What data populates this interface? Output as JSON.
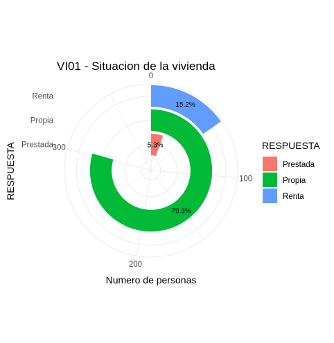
{
  "chart_data": {
    "type": "bar",
    "coord": "polar",
    "title": "VI01 - Situacion de la vivienda",
    "xlabel": "Numero de personas",
    "ylabel": "RESPUESTA",
    "categories": [
      "Prestada",
      "Propia",
      "Renta"
    ],
    "values": [
      20,
      302,
      58
    ],
    "data_labels": [
      "5.3%",
      "79.3%",
      "15.2%"
    ],
    "colors": [
      "#F8766D",
      "#00BA38",
      "#619CFF"
    ],
    "value_ticks": [
      0,
      100,
      200,
      300
    ],
    "value_range": [
      0,
      380
    ],
    "grid": true,
    "legend": {
      "title": "RESPUESTA",
      "position": "right",
      "entries": [
        "Prestada",
        "Propia",
        "Renta"
      ]
    }
  }
}
